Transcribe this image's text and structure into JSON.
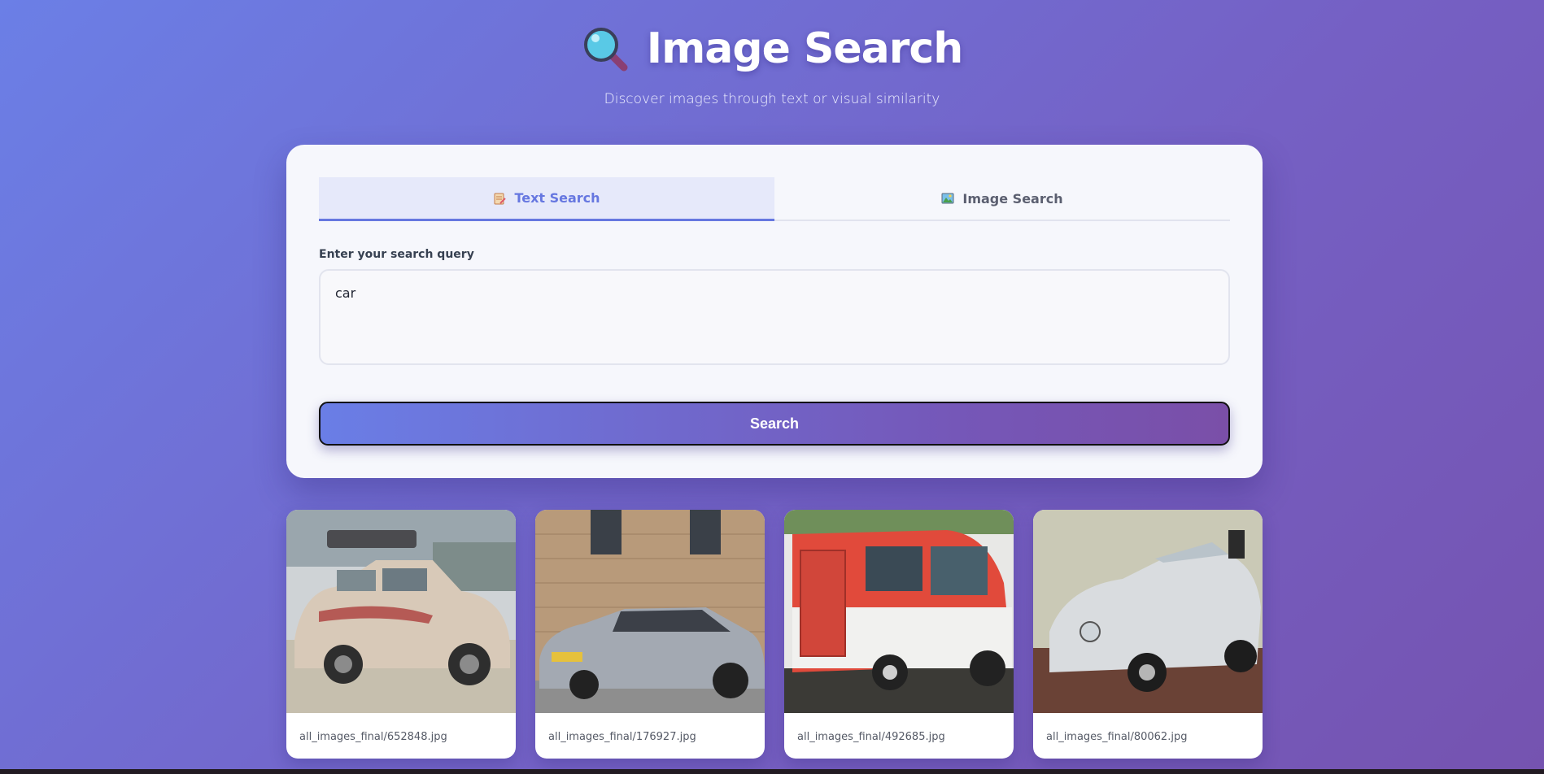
{
  "header": {
    "title": "Image Search",
    "subtitle": "Discover images through text or visual similarity",
    "icon": "magnifier-icon"
  },
  "tabs": [
    {
      "label": "Text Search",
      "icon": "memo-icon",
      "active": true
    },
    {
      "label": "Image Search",
      "icon": "picture-icon",
      "active": false
    }
  ],
  "query": {
    "label": "Enter your search query",
    "value": "car"
  },
  "search_button": {
    "label": "Search"
  },
  "results": [
    {
      "caption": "all_images_final/652848.jpg"
    },
    {
      "caption": "all_images_final/176927.jpg"
    },
    {
      "caption": "all_images_final/492685.jpg"
    },
    {
      "caption": "all_images_final/80062.jpg"
    }
  ],
  "colors": {
    "accent": "#6677e0",
    "background_start": "#6b7fe6",
    "background_end": "#7553b0"
  }
}
